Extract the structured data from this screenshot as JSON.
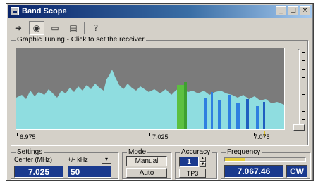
{
  "window": {
    "title": "Band Scope",
    "min": "_",
    "max": "□",
    "close": "×"
  },
  "toolbar": {
    "icons": [
      "arrow-icon",
      "record-icon",
      "folder-icon",
      "print-icon",
      "help-icon"
    ]
  },
  "graphic": {
    "legend": "Graphic Tuning - Click to set the receiver",
    "scale_labels": [
      "6.975",
      "7.025",
      "7.075"
    ],
    "marker_value": 7.06746,
    "slider_level": 0.86
  },
  "settings": {
    "legend": "Settings",
    "center_label": "Center (MHz)",
    "span_label": "+/- kHz",
    "center_value": "7.025",
    "span_value": "50",
    "dropdown": "▾"
  },
  "mode": {
    "legend": "Mode",
    "manual": "Manual",
    "auto": "Auto"
  },
  "accuracy": {
    "legend": "Accuracy",
    "value": "1",
    "button": "TP3"
  },
  "frequency": {
    "legend": "Frequency",
    "value": "7.067.46",
    "mode": "CW",
    "level": 0.25
  },
  "colors": {
    "spectrum": "#8fdde0",
    "signal_green": "#5cc040",
    "signal_blue": "#2f7fe0",
    "lcd": "#1a3a8e",
    "marker": "#e0c020"
  }
}
